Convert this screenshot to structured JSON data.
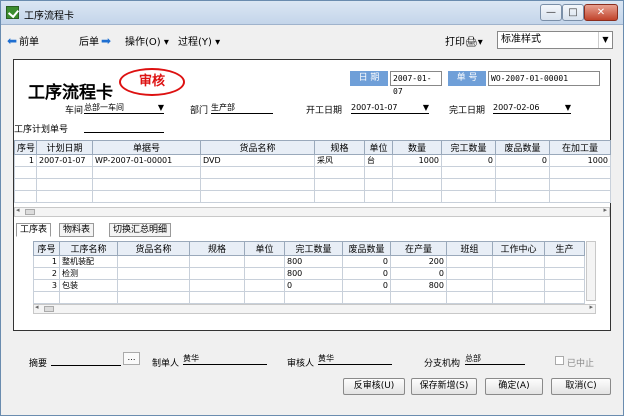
{
  "window": {
    "title": "工序流程卡",
    "minimize": "—",
    "maximize": "□",
    "close": "✕"
  },
  "toolbar": {
    "prev": "前单",
    "next": "后单",
    "operate": "操作(O)",
    "process": "过程(Y)",
    "print": "打印",
    "style_value": "标准样式"
  },
  "header": {
    "form_title": "工序流程卡",
    "stamp": "审核",
    "date_label": "日 期",
    "date_value": "2007-01-07",
    "no_label": "单 号",
    "no_value": "WO-2007-01-00001",
    "workshop_label": "车间",
    "workshop_value": "总部一车间",
    "dept_label": "部门",
    "dept_value": "生产部",
    "start_label": "开工日期",
    "start_value": "2007-01-07",
    "finish_label": "完工日期",
    "finish_value": "2007-02-06",
    "plan_label": "工序计划单号",
    "plan_value": ""
  },
  "main_table": {
    "columns": [
      "序号",
      "计划日期",
      "单据号",
      "货品名称",
      "规格",
      "单位",
      "数量",
      "完工数量",
      "废品数量",
      "在加工量"
    ],
    "rows": [
      [
        "1",
        "2007-01-07",
        "WP-2007-01-00001",
        "DVD",
        "采风",
        "台",
        "1000",
        "0",
        "0",
        "1000"
      ]
    ]
  },
  "tabs": [
    "工序表",
    "物料表",
    "切换汇总明细"
  ],
  "process_table": {
    "columns": [
      "序号",
      "工序名称",
      "货品名称",
      "规格",
      "单位",
      "完工数量",
      "废品数量",
      "在产量",
      "班组",
      "工作中心",
      "生产"
    ],
    "rows": [
      [
        "1",
        "整机装配",
        "",
        "",
        "",
        "800",
        "0",
        "200",
        "",
        "",
        ""
      ],
      [
        "2",
        "检测",
        "",
        "",
        "",
        "800",
        "0",
        "0",
        "",
        "",
        ""
      ],
      [
        "3",
        "包装",
        "",
        "",
        "",
        "0",
        "0",
        "800",
        "",
        "",
        ""
      ]
    ]
  },
  "footer": {
    "summary_label": "摘要",
    "summary_value": "",
    "maker_label": "制单人",
    "maker_value": "黄华",
    "auditor_label": "审核人",
    "auditor_value": "黄华",
    "branch_label": "分支机构",
    "branch_value": "总部",
    "stopped_label": "已中止",
    "buttons": {
      "unaudit": "反审核(U)",
      "save_new": "保存新增(S)",
      "ok": "确定(A)",
      "cancel": "取消(C)"
    }
  }
}
